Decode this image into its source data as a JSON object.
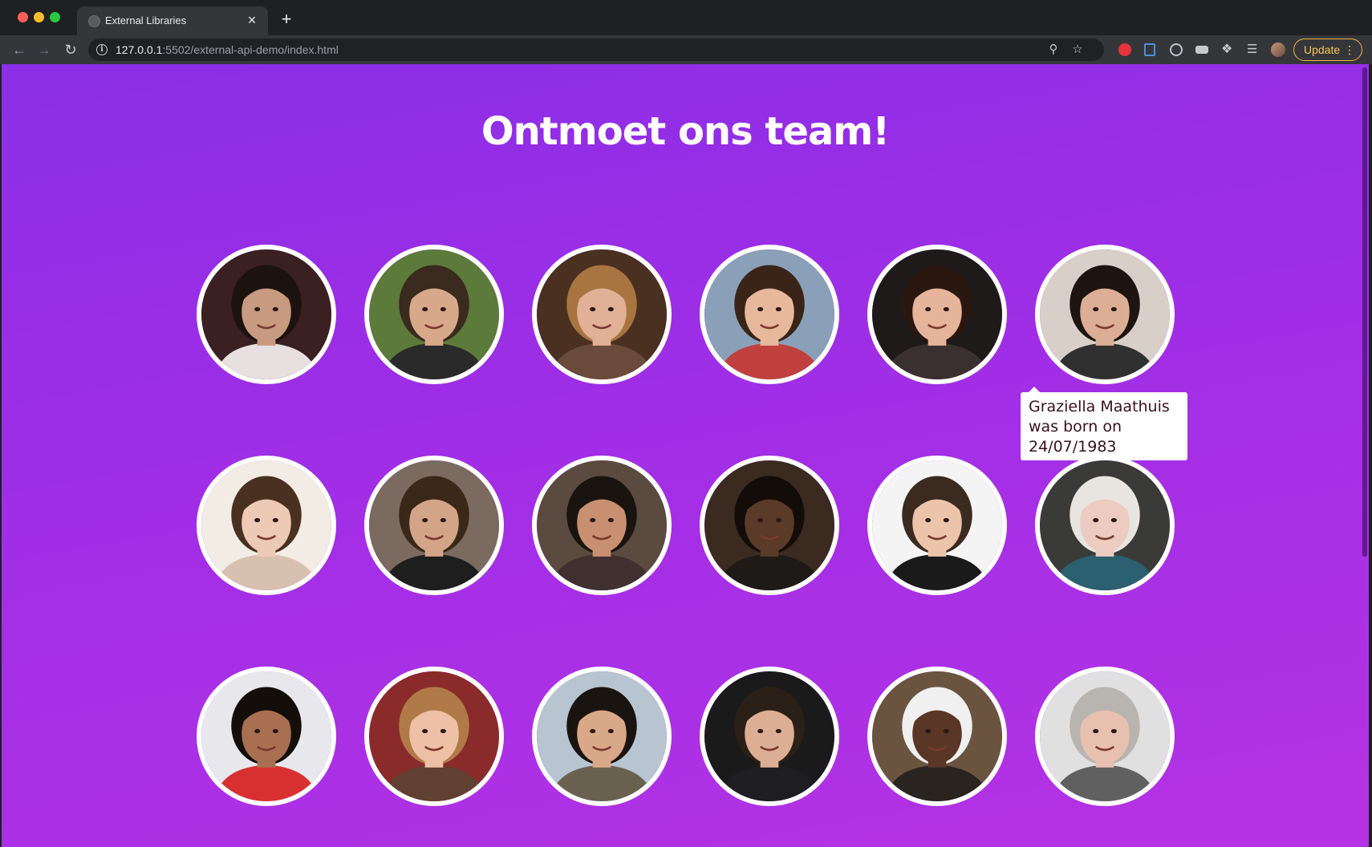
{
  "browser": {
    "tab_title": "External Libraries",
    "tab_close": "×",
    "new_tab": "+",
    "url_host": "127.0.0.1",
    "url_rest": ":5502/external-api-demo/index.html",
    "update_label": "Update",
    "icons": [
      "back-arrow-icon",
      "forward-arrow-icon",
      "reload-icon",
      "site-info-icon",
      "zoom-icon",
      "bookmark-star-icon",
      "extensions-puzzle-icon",
      "reading-list-icon",
      "profile-avatar",
      "more-menu-icon"
    ]
  },
  "page": {
    "title": "Ontmoet ons team!",
    "background_colors": [
      "#8b2ee6",
      "#b532e4"
    ]
  },
  "tooltip": {
    "text": "Graziella Maathuis was born on 24/07/1983"
  },
  "members": [
    {
      "skin": "#c89a80",
      "hair": "#1c120e",
      "bg": "#3a2020",
      "shirt": "#e8e0e0"
    },
    {
      "skin": "#d8a88a",
      "hair": "#3b2a1e",
      "bg": "#5c7a3a",
      "shirt": "#2a2a2a"
    },
    {
      "skin": "#e2b096",
      "hair": "#a87440",
      "bg": "#4a3020",
      "shirt": "#6a4a3a"
    },
    {
      "skin": "#e8b89c",
      "hair": "#3a2418",
      "bg": "#8aa0b8",
      "shirt": "#c04040"
    },
    {
      "skin": "#e6b49a",
      "hair": "#2a1810",
      "bg": "#1e1a1a",
      "shirt": "#3a3030"
    },
    {
      "skin": "#dcae96",
      "hair": "#1e1410",
      "bg": "#d8d0c8",
      "shirt": "#303030"
    },
    {
      "skin": "#eccab6",
      "hair": "#4a3020",
      "bg": "#f2ece4",
      "shirt": "#d8c0b0"
    },
    {
      "skin": "#d4a488",
      "hair": "#3a2818",
      "bg": "#7a6a60",
      "shirt": "#1e1e1e"
    },
    {
      "skin": "#c89070",
      "hair": "#1a1410",
      "bg": "#5a4a40",
      "shirt": "#403030"
    },
    {
      "skin": "#5a3a28",
      "hair": "#140c08",
      "bg": "#3a2a20",
      "shirt": "#1e1a18"
    },
    {
      "skin": "#ecc4aa",
      "hair": "#3a2a20",
      "bg": "#f4f4f4",
      "shirt": "#1a1a1a"
    },
    {
      "skin": "#ecccc0",
      "hair": "#e8e4e0",
      "bg": "#3a3a38",
      "shirt": "#2a6070"
    },
    {
      "skin": "#a87050",
      "hair": "#140e0a",
      "bg": "#e8e8ec",
      "shirt": "#d83030"
    },
    {
      "skin": "#eec0a6",
      "hair": "#b07a48",
      "bg": "#8a2a2a",
      "shirt": "#604030"
    },
    {
      "skin": "#d8a888",
      "hair": "#1a1410",
      "bg": "#b8c4d0",
      "shirt": "#6a6050"
    },
    {
      "skin": "#dcae94",
      "hair": "#2a2018",
      "bg": "#1a1a1a",
      "shirt": "#1e1e22"
    },
    {
      "skin": "#5a3626",
      "hair": "#f0f0f0",
      "bg": "#6a5440",
      "shirt": "#2a2420"
    },
    {
      "skin": "#e8c0b0",
      "hair": "#b8b4b0",
      "bg": "#e0e0e0",
      "shirt": "#606060"
    }
  ]
}
